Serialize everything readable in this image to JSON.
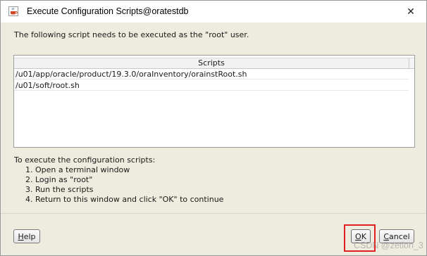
{
  "window": {
    "title": "Execute Configuration Scripts@oratestdb",
    "app_icon": "java-cup-icon",
    "close_icon": "close-icon",
    "close_glyph": "✕"
  },
  "message": "The following script needs to be executed as the \"root\" user.",
  "scripts_table": {
    "header": "Scripts",
    "rows": [
      "/u01/app/oracle/product/19.3.0/oraInventory/orainstRoot.sh",
      "/u01/soft/root.sh"
    ]
  },
  "instructions": {
    "intro": "To execute the configuration scripts:",
    "steps": [
      "1. Open a terminal window",
      "2. Login as \"root\"",
      "3. Run the scripts",
      "4. Return to this window and click \"OK\" to continue"
    ]
  },
  "buttons": {
    "help": {
      "mnemonic": "H",
      "rest": "elp"
    },
    "ok": {
      "mnemonic": "O",
      "rest": "K"
    },
    "cancel": {
      "mnemonic": "C",
      "rest": "ancel"
    }
  },
  "highlight_color": "#e02020",
  "watermark": "CSDN @zetion_3"
}
